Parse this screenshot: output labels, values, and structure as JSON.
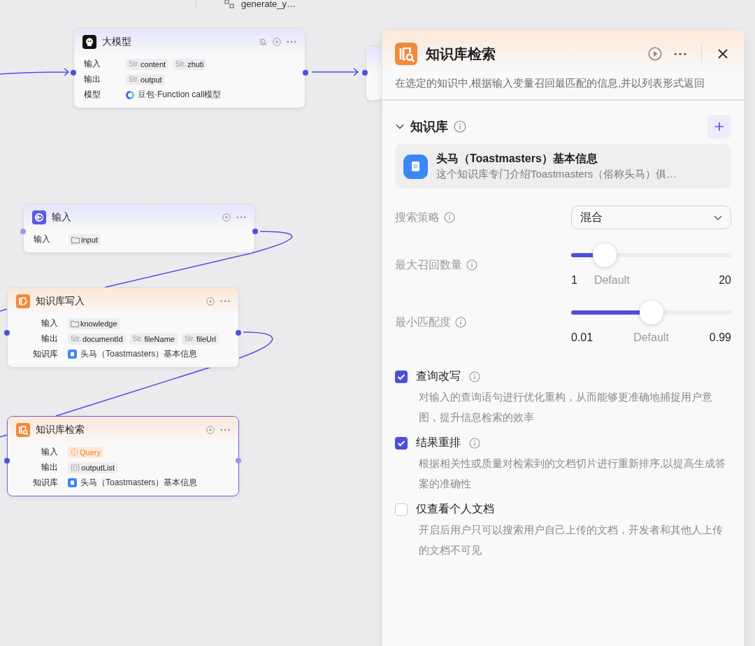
{
  "top_tabs": [
    {
      "label": "generate_y…",
      "selected": false
    }
  ],
  "nodes": [
    {
      "kind": "llm",
      "title": "大模型",
      "selected": false,
      "rows": [
        {
          "label": "输入",
          "tags": [
            {
              "kind": "str",
              "prefix": "Str.",
              "name": "content"
            },
            {
              "kind": "str",
              "prefix": "Str.",
              "name": "zhuti"
            }
          ]
        },
        {
          "label": "输出",
          "tags": [
            {
              "kind": "str",
              "prefix": "Str.",
              "name": "output"
            }
          ]
        },
        {
          "label": "模型",
          "value": {
            "kind": "model",
            "text": "豆包·Function call模型"
          }
        }
      ]
    },
    {
      "kind": "partial",
      "selected": false
    },
    {
      "kind": "input",
      "title": "输入",
      "selected": false,
      "rows": [
        {
          "label": "输入",
          "tags": [
            {
              "kind": "object",
              "name": "input"
            }
          ]
        }
      ]
    },
    {
      "kind": "kb_write",
      "title": "知识库写入",
      "selected": false,
      "rows": [
        {
          "label": "输入",
          "tags": [
            {
              "kind": "object",
              "name": "knowledge"
            }
          ]
        },
        {
          "label": "输出",
          "tags": [
            {
              "kind": "str",
              "prefix": "Str.",
              "name": "documentId"
            },
            {
              "kind": "str",
              "prefix": "Str.",
              "name": "fileName"
            },
            {
              "kind": "str",
              "prefix": "Str.",
              "name": "fileUrl"
            }
          ]
        },
        {
          "label": "知识库",
          "value": {
            "kind": "kb",
            "text": "头马（Toastmasters）基本信息"
          }
        }
      ]
    },
    {
      "kind": "kb_search",
      "title": "知识库检索",
      "selected": true,
      "rows": [
        {
          "label": "输入",
          "tags": [
            {
              "kind": "warning",
              "name": "Query"
            }
          ]
        },
        {
          "label": "输出",
          "tags": [
            {
              "kind": "array",
              "prefix": "{()}",
              "name": "outputList"
            }
          ]
        },
        {
          "label": "知识库",
          "value": {
            "kind": "kb",
            "text": "头马（Toastmasters）基本信息"
          }
        }
      ]
    }
  ],
  "panel": {
    "title": "知识库检索",
    "description": "在选定的知识中,根据输入变量召回最匹配的信息,并以列表形式返回",
    "section": {
      "title": "知识库",
      "expanded": true,
      "items": [
        {
          "title": "头马（Toastmasters）基本信息",
          "subtitle": "这个知识库专门介绍Toastmasters（俗称头马）俱…"
        }
      ]
    },
    "strategy": {
      "label": "搜索策略",
      "value": "混合"
    },
    "sliders": [
      {
        "label": "最大召回数量",
        "level": 0.21,
        "min": "1",
        "default": "Default",
        "max": "20"
      },
      {
        "label": "最小匹配度",
        "level": 0.5,
        "min": "0.01",
        "default": "Default",
        "max": "0.99"
      }
    ],
    "options": [
      {
        "label": "查询改写",
        "checked": true,
        "info": true,
        "description": "对输入的查询语句进行优化重构，从而能够更准确地捕捉用户意图，提升信息检索的效率"
      },
      {
        "label": "结果重排",
        "checked": true,
        "info": true,
        "description": "根据相关性或质量对检索到的文档切片进行重新排序,以提高生成答案的准确性"
      },
      {
        "label": "仅查看个人文档",
        "checked": false,
        "info": false,
        "description": "开启后用户只可以搜索用户自己上传的文档，开发者和其他人上传的文档不可见"
      }
    ]
  }
}
